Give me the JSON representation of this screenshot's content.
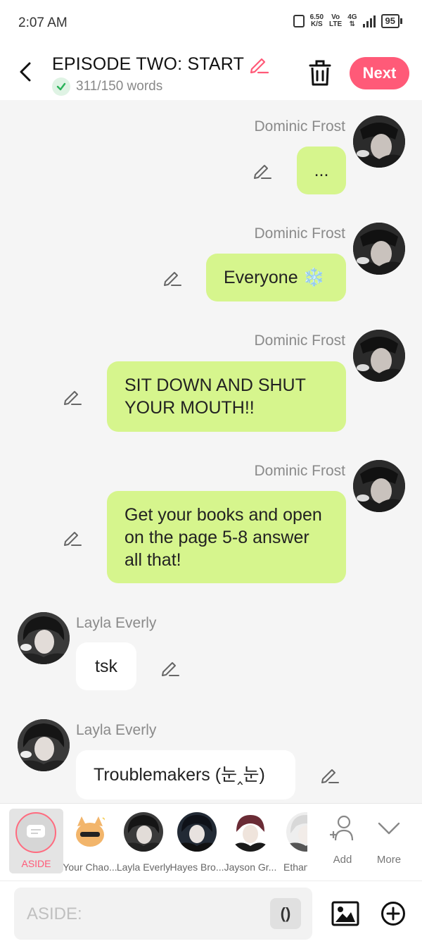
{
  "status_bar": {
    "time": "2:07 AM",
    "net_speed": "6.50",
    "net_unit": "K/S",
    "volte_top": "Vo",
    "volte_bottom": "LTE",
    "network_type": "4G",
    "battery": "95"
  },
  "header": {
    "title": "EPISODE TWO: START",
    "word_count": "311/150 words",
    "next_label": "Next",
    "accent_color": "#ff5a78"
  },
  "messages": [
    {
      "sender": "Dominic Frost",
      "text": "...",
      "side": "right"
    },
    {
      "sender": "Dominic Frost",
      "text": "Everyone ❄️",
      "side": "right"
    },
    {
      "sender": "Dominic Frost",
      "text": "SIT DOWN AND SHUT YOUR MOUTH!!",
      "side": "right"
    },
    {
      "sender": "Dominic Frost",
      "text": "Get your books and open on the page 5-8 answer all that!",
      "side": "right"
    },
    {
      "sender": "Layla Everly",
      "text": "tsk",
      "side": "left"
    },
    {
      "sender": "Layla Everly",
      "text": "Troublemakers (눈‸눈)",
      "side": "left"
    }
  ],
  "characters": {
    "aside_label": "ASIDE",
    "items": [
      {
        "label": "Your Chao..."
      },
      {
        "label": "Layla Everly"
      },
      {
        "label": "Hayes Bro..."
      },
      {
        "label": "Jayson Gr..."
      },
      {
        "label": "Ethan"
      }
    ],
    "add_label": "Add",
    "more_label": "More"
  },
  "input": {
    "placeholder": "ASIDE:",
    "paren_button": "()"
  },
  "colors": {
    "bubble_green": "#d6f58d",
    "next_button": "#ff5a78",
    "check_green": "#2bb35a"
  }
}
